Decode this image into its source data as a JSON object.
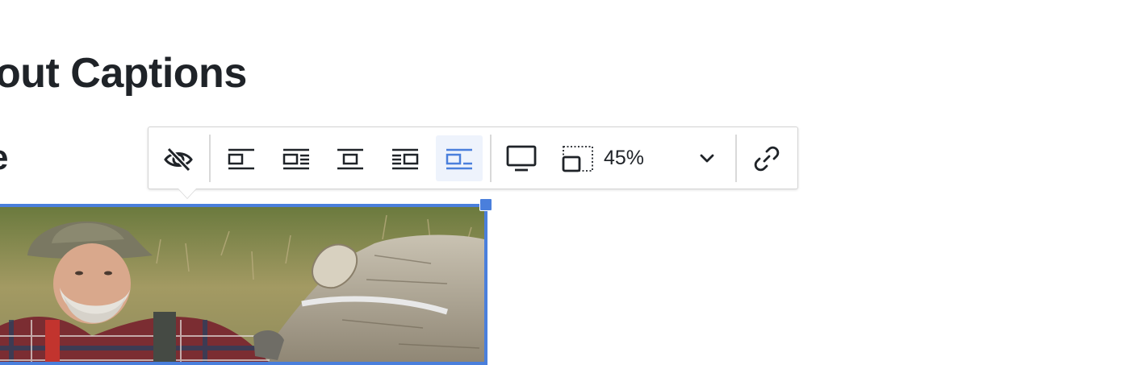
{
  "page": {
    "heading": "out Captions",
    "subheading": "e"
  },
  "toolbar": {
    "buttons": [
      {
        "name": "toggle-caption-button",
        "icon": "eye-slash-icon"
      },
      {
        "name": "align-left-button",
        "icon": "align-left-icon"
      },
      {
        "name": "wrap-text-right-button",
        "icon": "wrap-right-icon"
      },
      {
        "name": "align-center-button",
        "icon": "align-center-icon"
      },
      {
        "name": "wrap-text-left-button",
        "icon": "wrap-left-icon"
      },
      {
        "name": "align-inline-button",
        "icon": "inline-icon",
        "active": true
      },
      {
        "name": "full-size-button",
        "icon": "monitor-icon"
      },
      {
        "name": "resize-button",
        "icon": "resize-icon"
      },
      {
        "name": "link-button",
        "icon": "link-icon"
      }
    ],
    "zoom": "45%",
    "zoom_dropdown_icon": "chevron-down-icon"
  },
  "colors": {
    "accent": "#4a7fdc",
    "active_bg": "#eef3fc",
    "text": "#1f2328"
  },
  "image": {
    "subject": "photo of elderly man in plaid shirt and bucket hat beside a fallen log"
  }
}
